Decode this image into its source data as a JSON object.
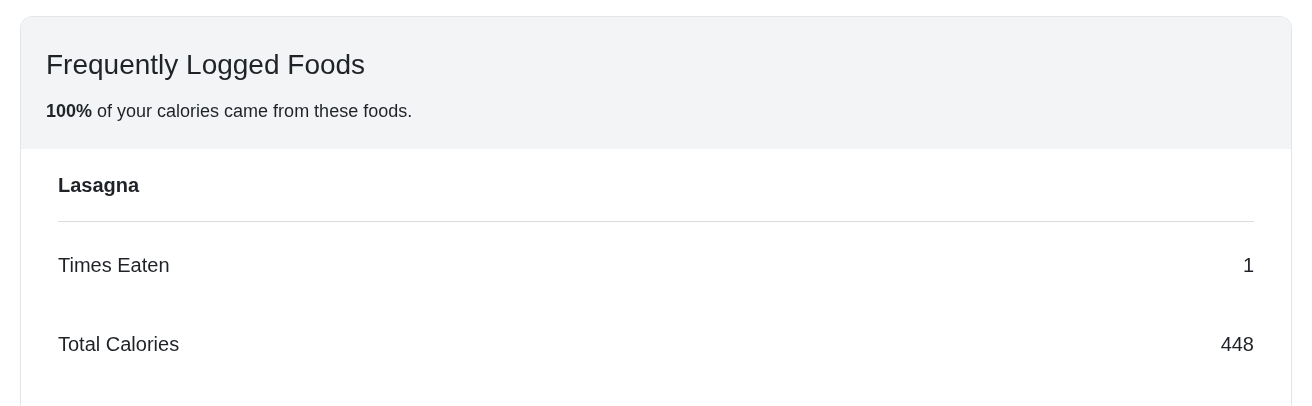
{
  "card": {
    "title": "Frequently Logged Foods",
    "subtitle": "**100%** of your calories came from these foods.",
    "foods": [
      {
        "name": "Lasagna",
        "stats": [
          {
            "label": "Times Eaten",
            "value": "1"
          },
          {
            "label": "Total Calories",
            "value": "448"
          }
        ]
      }
    ]
  }
}
